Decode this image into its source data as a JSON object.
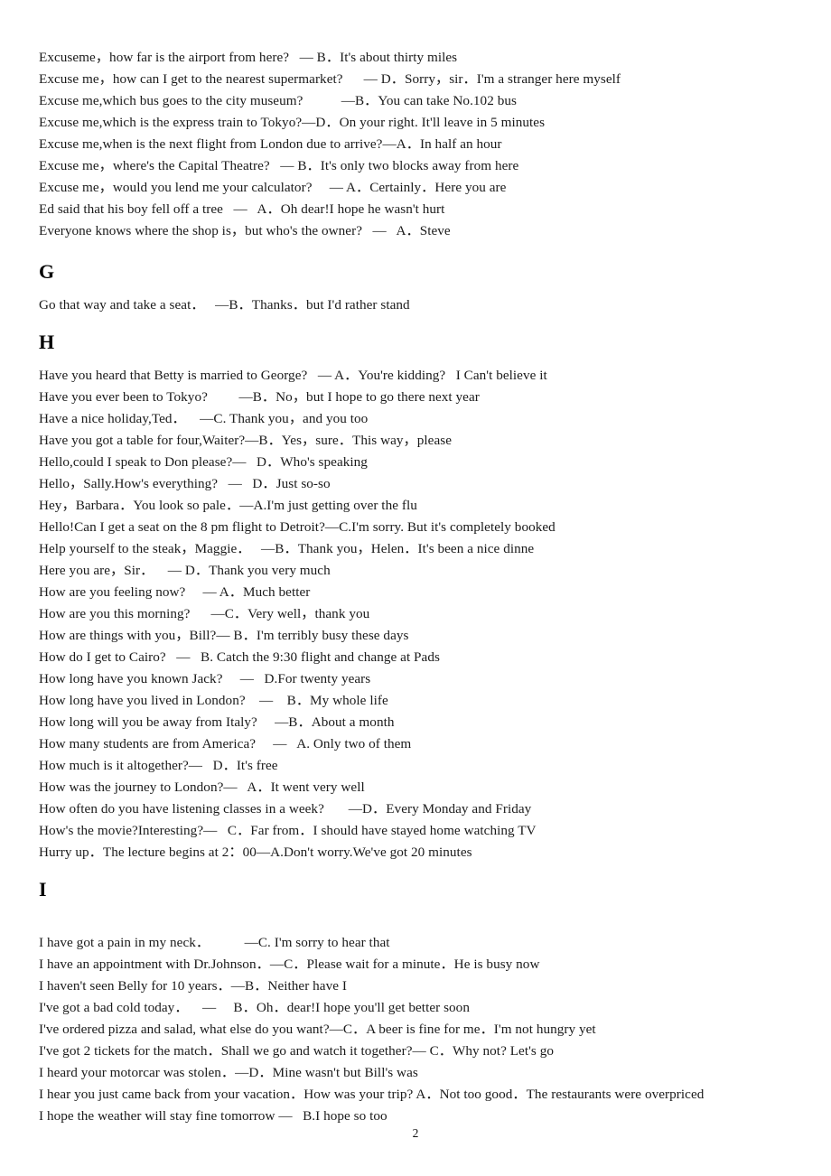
{
  "document": {
    "page_number": "2",
    "sections": [
      {
        "heading": null,
        "lines": [
          "Excuseme，how far is the airport from here?   — B．It's about thirty miles",
          "Excuse me，how can I get to the nearest supermarket?      — D．Sorry，sir．I'm a stranger here myself",
          "Excuse me,which bus goes to the city museum?           —B．You can take No.102 bus",
          "Excuse me,which is the express train to Tokyo?—D．On your right. It'll leave in 5 minutes",
          "Excuse me,when is the next flight from London due to arrive?—A．In half an hour",
          "Excuse me，where's the Capital Theatre?   — B．It's only two blocks away from here",
          "Excuse me，would you lend me your calculator?     — A．Certainly．Here you are",
          "Ed said that his boy fell off a tree   —   A．Oh dear!I hope he wasn't hurt",
          "Everyone knows where the shop is，but who's the owner?   —   A．Steve"
        ]
      },
      {
        "heading": "G",
        "lines": [
          "Go that way and take a seat．   —B．Thanks．but I'd rather stand"
        ]
      },
      {
        "heading": "H",
        "lines": [
          "Have you heard that Betty is married to George?   — A．You're kidding?   I Can't believe it",
          "Have you ever been to Tokyo?         —B．No，but I hope to go there next year",
          "Have a nice holiday,Ted．    —C. Thank you，and you too",
          "Have you got a table for four,Waiter?—B．Yes，sure．This way，please",
          "Hello,could I speak to Don please?—   D．Who's speaking",
          "Hello，Sally.How's everything?   —   D．Just so-so",
          "Hey，Barbara．You look so pale．—A.I'm just getting over the flu",
          "Hello!Can I get a seat on the 8 pm flight to Detroit?—C.I'm sorry. But it's completely booked",
          "Help yourself to the steak，Maggie．   —B．Thank you，Helen．It's been a nice dinne",
          "Here you are，Sir．    — D．Thank you very much",
          "How are you feeling now?     — A．Much better",
          "How are you this morning?      —C．Very well，thank you",
          "How are things with you，Bill?— B．I'm terribly busy these days",
          "How do I get to Cairo?   —   B. Catch the 9:30 flight and change at Pads",
          "How long have you known Jack?     —   D.For twenty years",
          "How long have you lived in London?    —    B．My whole life",
          "How long will you be away from Italy?     —B．About a month",
          "How many students are from America?     —   A. Only two of them",
          "How much is it altogether?—   D．It's free",
          "How was the journey to London?—   A．It went very well",
          "How often do you have listening classes in a week?       —D．Every Monday and Friday",
          "How's the movie?Interesting?—   C．Far from．I should have stayed home watching TV",
          "Hurry up．The lecture begins at 2：00—A.Don't worry.We've got 20 minutes"
        ]
      },
      {
        "heading": "I",
        "extra_gap": true,
        "lines": [
          "I have got a pain in my neck．          —C. I'm sorry to hear that",
          "I have an appointment with Dr.Johnson．—C．Please wait for a minute．He is busy now",
          "I haven't seen Belly for 10 years．—B．Neither have I",
          "I've got a bad cold today．    —     B．Oh．dear!I hope you'll get better soon",
          "I've ordered pizza and salad, what else do you want?—C．A beer is fine for me．I'm not hungry yet",
          "I've got 2 tickets for the match．Shall we go and watch it together?— C．Why not? Let's go",
          "I heard your motorcar was stolen．—D．Mine wasn't but Bill's was",
          "I hear you just came back from your vacation．How was your trip? A．Not too good．The restaurants were overpriced",
          "I hope the weather will stay fine tomorrow —   B.I hope so too"
        ]
      }
    ]
  }
}
